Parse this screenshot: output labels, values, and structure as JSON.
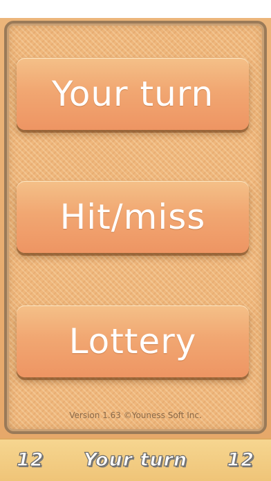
{
  "menu": {
    "your_turn_label": "Your turn",
    "hit_miss_label": "Hit/miss",
    "lottery_label": "Lottery"
  },
  "footer": {
    "version_text": "Version 1.63 ©Youness Soft Inc."
  },
  "status_bar": {
    "left_count": "12",
    "mode_label": "Your turn",
    "right_count": "12"
  },
  "colors": {
    "background": "#e8a868",
    "button_top": "#f4c088",
    "button_bottom": "#ee9563",
    "panel_border": "#9a7a58",
    "bottom_bar": "#f6d690"
  }
}
